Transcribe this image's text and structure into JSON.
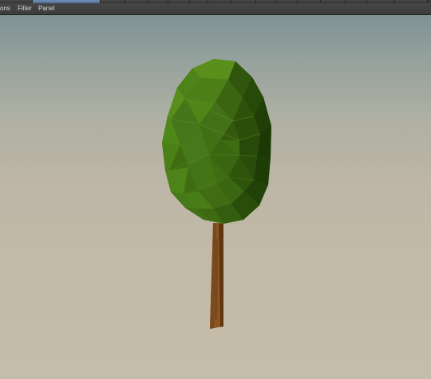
{
  "menubar": {
    "items": [
      {
        "label": "ons"
      },
      {
        "label": "Filter"
      },
      {
        "label": "Panel"
      }
    ]
  },
  "viewport": {
    "object": "tree",
    "colors": {
      "sky_top": "#7f9294",
      "ground": "#c6bcaa",
      "foliage": "#3f6b12",
      "trunk": "#7a4a1c"
    }
  }
}
